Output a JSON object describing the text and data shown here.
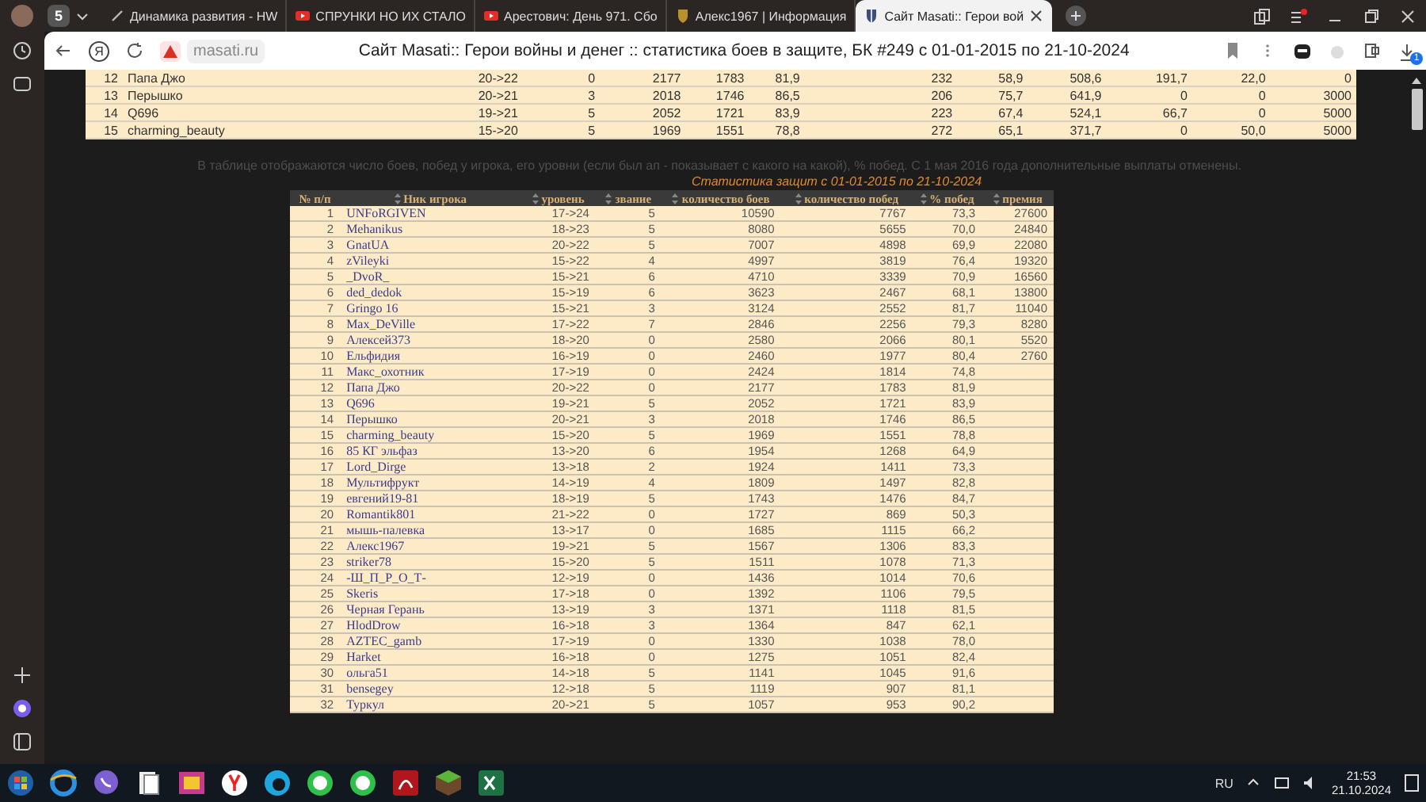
{
  "browser": {
    "tabs": [
      {
        "kind": "pen",
        "label": "Динамика развития - HW",
        "selected": false
      },
      {
        "kind": "video",
        "label": "СПРУНКИ НО ИХ СТАЛО",
        "selected": false
      },
      {
        "kind": "video",
        "label": "Арестович: День 971. Сбо",
        "selected": false
      },
      {
        "kind": "crest",
        "label": "Алекс1967 | Информация",
        "selected": false
      },
      {
        "kind": "shield",
        "label": "Сайт Masati:: Герои вой",
        "selected": true
      }
    ],
    "tab_count": "5",
    "logo_letter": "Я",
    "domain": "masati.ru",
    "page_title": "Сайт Masati:: Герои войны и денег :: статистика боев в защите, БК #249 с 01-01-2015 по 21-10-2024",
    "downloads_badge": "1"
  },
  "top_table": {
    "rows": [
      [
        "12",
        "Папа Джо",
        "20->22",
        "0",
        "2177",
        "1783",
        "81,9",
        "232",
        "58,9",
        "508,6",
        "191,7",
        "22,0",
        "0"
      ],
      [
        "13",
        "Перышко",
        "20->21",
        "3",
        "2018",
        "1746",
        "86,5",
        "206",
        "75,7",
        "641,9",
        "0",
        "0",
        "3000"
      ],
      [
        "14",
        "Q696",
        "19->21",
        "5",
        "2052",
        "1721",
        "83,9",
        "223",
        "67,4",
        "524,1",
        "66,7",
        "0",
        "5000"
      ],
      [
        "15",
        "charming_beauty",
        "15->20",
        "5",
        "1969",
        "1551",
        "78,8",
        "272",
        "65,1",
        "371,7",
        "0",
        "50,0",
        "5000"
      ]
    ]
  },
  "note": "В таблице отображаются число боев, побед у игрока, его уровни (если был ап - показывает с какого на какой), % побед. С 1 мая 2016 года дополнительные выплаты отменены.",
  "stats_caption": "Статистика защит с 01-01-2015 по 21-10-2024",
  "table": {
    "columns": [
      "№ п/п",
      "Ник игрока",
      "уровень",
      "звание",
      "количество боев",
      "количество побед",
      "% побед",
      "премия"
    ],
    "rows": [
      [
        "1",
        "UNFoRGIVEN",
        "17->24",
        "5",
        "10590",
        "7767",
        "73,3",
        "27600"
      ],
      [
        "2",
        "Mehanikus",
        "18->23",
        "5",
        "8080",
        "5655",
        "70,0",
        "24840"
      ],
      [
        "3",
        "GnatUA",
        "20->22",
        "5",
        "7007",
        "4898",
        "69,9",
        "22080"
      ],
      [
        "4",
        "zVileyki",
        "15->22",
        "4",
        "4997",
        "3819",
        "76,4",
        "19320"
      ],
      [
        "5",
        "_DvoR_",
        "15->21",
        "6",
        "4710",
        "3339",
        "70,9",
        "16560"
      ],
      [
        "6",
        "ded_dedok",
        "15->19",
        "6",
        "3623",
        "2467",
        "68,1",
        "13800"
      ],
      [
        "7",
        "Gringo 16",
        "15->21",
        "3",
        "3124",
        "2552",
        "81,7",
        "11040"
      ],
      [
        "8",
        "Max_DeVille",
        "17->22",
        "7",
        "2846",
        "2256",
        "79,3",
        "8280"
      ],
      [
        "9",
        "Алексей373",
        "18->20",
        "0",
        "2580",
        "2066",
        "80,1",
        "5520"
      ],
      [
        "10",
        "Ельфидия",
        "16->19",
        "0",
        "2460",
        "1977",
        "80,4",
        "2760"
      ],
      [
        "11",
        "Макс_охотник",
        "17->19",
        "0",
        "2424",
        "1814",
        "74,8"
      ],
      [
        "12",
        "Папа Джо",
        "20->22",
        "0",
        "2177",
        "1783",
        "81,9"
      ],
      [
        "13",
        "Q696",
        "19->21",
        "5",
        "2052",
        "1721",
        "83,9"
      ],
      [
        "14",
        "Перышко",
        "20->21",
        "3",
        "2018",
        "1746",
        "86,5"
      ],
      [
        "15",
        "charming_beauty",
        "15->20",
        "5",
        "1969",
        "1551",
        "78,8"
      ],
      [
        "16",
        "85 КГ эльфаз",
        "13->20",
        "6",
        "1954",
        "1268",
        "64,9"
      ],
      [
        "17",
        "Lord_Dirge",
        "13->18",
        "2",
        "1924",
        "1411",
        "73,3"
      ],
      [
        "18",
        "Мультифрукт",
        "14->19",
        "4",
        "1809",
        "1497",
        "82,8"
      ],
      [
        "19",
        "евгений19-81",
        "18->19",
        "5",
        "1743",
        "1476",
        "84,7"
      ],
      [
        "20",
        "Romantik801",
        "21->22",
        "0",
        "1727",
        "869",
        "50,3"
      ],
      [
        "21",
        "мышь-палевка",
        "13->17",
        "0",
        "1685",
        "1115",
        "66,2"
      ],
      [
        "22",
        "Алекс1967",
        "19->21",
        "5",
        "1567",
        "1306",
        "83,3"
      ],
      [
        "23",
        "striker78",
        "15->20",
        "5",
        "1511",
        "1078",
        "71,3"
      ],
      [
        "24",
        "-Ш_П_Р_О_Т-",
        "12->19",
        "0",
        "1436",
        "1014",
        "70,6"
      ],
      [
        "25",
        "Skeris",
        "17->18",
        "0",
        "1392",
        "1106",
        "79,5"
      ],
      [
        "26",
        "Черная Герань",
        "13->19",
        "3",
        "1371",
        "1118",
        "81,5"
      ],
      [
        "27",
        "HlodDrow",
        "16->18",
        "3",
        "1364",
        "847",
        "62,1"
      ],
      [
        "28",
        "AZTEC_gamb",
        "17->19",
        "0",
        "1330",
        "1038",
        "78,0"
      ],
      [
        "29",
        "Harket",
        "16->18",
        "0",
        "1275",
        "1051",
        "82,4"
      ],
      [
        "30",
        "ольга51",
        "14->18",
        "5",
        "1141",
        "1045",
        "91,6"
      ],
      [
        "31",
        "bensegey",
        "12->18",
        "5",
        "1119",
        "907",
        "81,1"
      ],
      [
        "32",
        "Туркул",
        "20->21",
        "5",
        "1057",
        "953",
        "90,2"
      ]
    ]
  },
  "taskbar": {
    "language": "RU",
    "time": "21:53",
    "date": "21.10.2024"
  }
}
